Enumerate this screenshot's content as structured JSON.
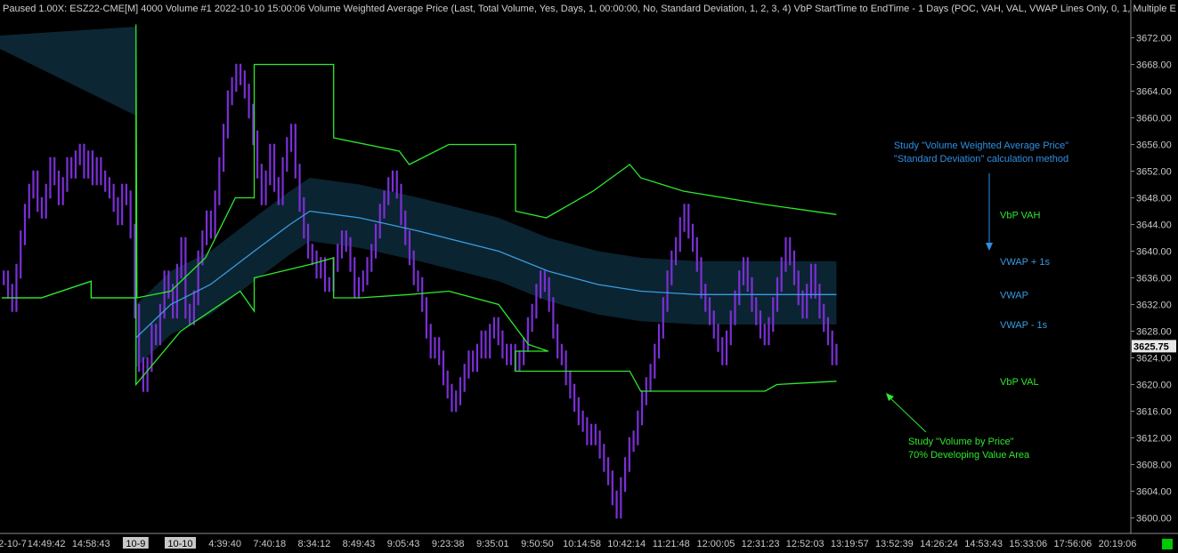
{
  "header": {
    "text": "Paused 1.00X: ESZ22-CME[M]  4000 Volume  #1 2022-10-10 15:00:06 Volume Weighted Average Price   (Last, Total Volume, Yes, Days, 1, 00:00:00, No, Standard Deviation, 1, 2, 3, 4)  VbP StartTime to EndTime - 1 Days   (POC, VAH, VAL, VWAP Lines Only, 0, 1, Multiple E"
  },
  "colors": {
    "background": "#000000",
    "bars": "#7b2fd6",
    "vbp": "#2ee82e",
    "vwap": "#3a9be0",
    "band": "#0c2634",
    "annotation_blue": "#2f8fe6",
    "annotation_green": "#2ee82e"
  },
  "chart_data": {
    "type": "line",
    "y_axis": {
      "ylim": [
        3599,
        3675
      ],
      "ticks": [
        "3672.00",
        "3668.00",
        "3664.00",
        "3660.00",
        "3656.00",
        "3652.00",
        "3648.00",
        "3644.00",
        "3640.00",
        "3636.00",
        "3632.00",
        "3628.00",
        "3624.00",
        "3620.00",
        "3616.00",
        "3612.00",
        "3608.00",
        "3604.00",
        "3600.00"
      ],
      "current_price": "3625.75"
    },
    "x_axis": {
      "tick_labels": [
        "2-10-7",
        "14:49:42",
        "14:58:43",
        "10-9",
        "10-10",
        "4:39:40",
        "7:40:18",
        "8:34:12",
        "8:49:43",
        "9:05:43",
        "9:23:38",
        "9:35:01",
        "9:50:50",
        "10:14:58",
        "10:42:14",
        "11:21:48",
        "12:00:05",
        "12:31:23",
        "12:52:03",
        "13:19:57",
        "13:52:39",
        "14:26:24",
        "14:53:43",
        "15:33:06",
        "17:56:06",
        "20:19:06"
      ],
      "highlighted": [
        "10-9",
        "10-10"
      ]
    },
    "series": [
      {
        "kind": "price",
        "values": [
          3636,
          3634,
          3632,
          3637,
          3642,
          3646,
          3649,
          3651,
          3647,
          3646,
          3649,
          3653,
          3651,
          3648,
          3650,
          3653,
          3652,
          3654,
          3655,
          3652,
          3654,
          3651,
          3653,
          3651,
          3650,
          3649,
          3647,
          3645,
          3649,
          3648,
          3643,
          3631,
          3623,
          3620,
          3623,
          3628,
          3627,
          3631,
          3636,
          3634,
          3631,
          3637,
          3641,
          3631,
          3630,
          3633,
          3639,
          3642,
          3645,
          3643,
          3648,
          3653,
          3658,
          3663,
          3665,
          3667,
          3666,
          3664,
          3661,
          3657,
          3652,
          3648,
          3651,
          3655,
          3650,
          3648,
          3653,
          3656,
          3658,
          3652,
          3647,
          3643,
          3640,
          3639,
          3637,
          3638,
          3635,
          3635,
          3638,
          3640,
          3642,
          3641,
          3638,
          3634,
          3635,
          3636,
          3638,
          3640,
          3643,
          3646,
          3648,
          3650,
          3651,
          3649,
          3645,
          3642,
          3639,
          3636,
          3635,
          3632,
          3628,
          3625,
          3626,
          3624,
          3621,
          3619,
          3617,
          3618,
          3620,
          3622,
          3624,
          3623,
          3625,
          3627,
          3625,
          3628,
          3629,
          3627,
          3625,
          3624,
          3625,
          3623,
          3624,
          3626,
          3629,
          3631,
          3634,
          3636,
          3635,
          3632,
          3628,
          3625,
          3624,
          3621,
          3619,
          3617,
          3615,
          3614,
          3612,
          3613,
          3612,
          3610,
          3608,
          3606,
          3603,
          3601,
          3605,
          3608,
          3611,
          3612,
          3615,
          3618,
          3620,
          3622,
          3625,
          3628,
          3632,
          3636,
          3639,
          3641,
          3644,
          3646,
          3643,
          3641,
          3638,
          3634,
          3632,
          3630,
          3628,
          3626,
          3624,
          3627,
          3630,
          3633,
          3636,
          3638,
          3635,
          3632,
          3630,
          3628,
          3627,
          3629,
          3632,
          3635,
          3638,
          3641,
          3639,
          3636,
          3633,
          3631,
          3634,
          3637,
          3634,
          3631,
          3629,
          3627,
          3624,
          3625
        ]
      },
      {
        "name": "VbP VAH",
        "kind": "step",
        "points": [
          [
            0,
            3633
          ],
          [
            0.04,
            3633
          ],
          [
            0.09,
            3635.5
          ],
          [
            0.09,
            3633
          ],
          [
            0.135,
            3633
          ],
          [
            0.135,
            3674
          ],
          [
            0.136,
            3633
          ],
          [
            0.17,
            3634
          ],
          [
            0.205,
            3639
          ],
          [
            0.235,
            3648
          ],
          [
            0.254,
            3648
          ],
          [
            0.254,
            3668
          ],
          [
            0.334,
            3668
          ],
          [
            0.334,
            3657
          ],
          [
            0.4,
            3655
          ],
          [
            0.41,
            3653
          ],
          [
            0.45,
            3656
          ],
          [
            0.517,
            3656
          ],
          [
            0.517,
            3646
          ],
          [
            0.548,
            3645
          ],
          [
            0.595,
            3649
          ],
          [
            0.632,
            3653
          ],
          [
            0.643,
            3651
          ],
          [
            0.686,
            3649
          ],
          [
            0.768,
            3647
          ],
          [
            0.84,
            3645.5
          ]
        ]
      },
      {
        "name": "VbP VAL",
        "kind": "step",
        "points": [
          [
            0,
            3633
          ],
          [
            0.04,
            3633
          ],
          [
            0.09,
            3635.5
          ],
          [
            0.09,
            3633
          ],
          [
            0.135,
            3633
          ],
          [
            0.135,
            3620
          ],
          [
            0.18,
            3628
          ],
          [
            0.24,
            3634
          ],
          [
            0.254,
            3631
          ],
          [
            0.254,
            3636
          ],
          [
            0.31,
            3638
          ],
          [
            0.334,
            3639
          ],
          [
            0.334,
            3633
          ],
          [
            0.36,
            3633
          ],
          [
            0.41,
            3633.5
          ],
          [
            0.45,
            3634
          ],
          [
            0.5,
            3632
          ],
          [
            0.53,
            3626
          ],
          [
            0.55,
            3625
          ],
          [
            0.517,
            3625
          ],
          [
            0.517,
            3622
          ],
          [
            0.548,
            3622
          ],
          [
            0.632,
            3622
          ],
          [
            0.643,
            3619
          ],
          [
            0.686,
            3619
          ],
          [
            0.768,
            3619
          ],
          [
            0.78,
            3620
          ],
          [
            0.84,
            3620.5
          ]
        ]
      },
      {
        "name": "VWAP",
        "kind": "line",
        "points": [
          [
            0.135,
            3627
          ],
          [
            0.17,
            3632
          ],
          [
            0.21,
            3635
          ],
          [
            0.254,
            3640
          ],
          [
            0.29,
            3644
          ],
          [
            0.31,
            3646
          ],
          [
            0.36,
            3645
          ],
          [
            0.42,
            3643
          ],
          [
            0.5,
            3640
          ],
          [
            0.55,
            3637
          ],
          [
            0.6,
            3635
          ],
          [
            0.643,
            3634
          ],
          [
            0.7,
            3633.5
          ],
          [
            0.76,
            3633.5
          ],
          [
            0.84,
            3633.5
          ]
        ]
      }
    ],
    "line_labels": [
      "VbP VAH",
      "VWAP + 1s",
      "VWAP",
      "VWAP - 1s",
      "VbP VAL"
    ],
    "annotations": [
      {
        "lines": [
          "Study \"Volume Weighted Average Price\"",
          "\"Standard Deviation\" calculation method"
        ],
        "color": "blue"
      },
      {
        "lines": [
          "Study \"Volume by Price\"",
          "70% Developing Value Area"
        ],
        "color": "green"
      }
    ]
  }
}
